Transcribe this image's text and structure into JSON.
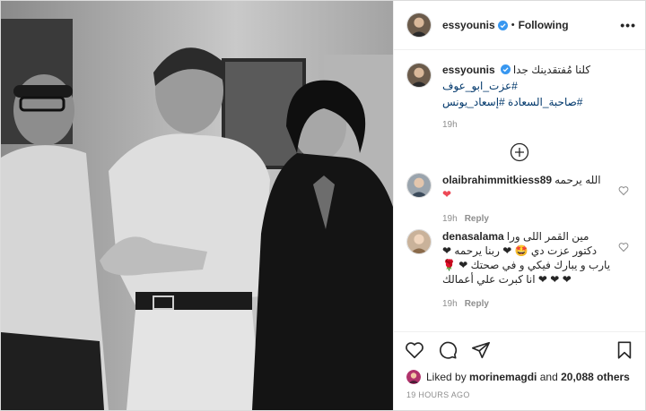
{
  "header": {
    "username": "essyounis",
    "separator": "•",
    "follow_label": "Following",
    "more_label": "•••"
  },
  "caption": {
    "username": "essyounis",
    "text": "كلنا مُفتقدينك جدا",
    "tags": [
      "#عزت_ابو_عوف",
      "#إسعاد_يونس",
      "#صاحبة_السعادة"
    ],
    "time": "19h"
  },
  "comments": [
    {
      "username": "olaibrahimmitkiess89",
      "text": "الله يرحمه",
      "emoji": "❤",
      "time": "19h",
      "reply_label": "Reply"
    },
    {
      "username": "denasalama",
      "text": "مين القمر اللى ورا دكتور عزت دي 🤩 ❤ ربنا يرحمه ❤ يارب و يبارك فيكي و في صحتك ❤ 🌹❤ ❤ ❤ انا كبرت علي أعمالك",
      "time": "19h",
      "reply_label": "Reply"
    }
  ],
  "likes": {
    "prefix": "Liked by",
    "user": "morinemagdi",
    "conjunction": "and",
    "others": "20,088 others"
  },
  "posted_ago": "19 HOURS AGO",
  "icons": {
    "verified": "verified-badge-icon",
    "like": "heart-outline-icon",
    "comment": "comment-bubble-icon",
    "share": "paper-plane-icon",
    "save": "bookmark-icon",
    "load_more": "plus-circle-icon"
  },
  "colors": {
    "verified": "#3897f0",
    "heart": "#ed4956",
    "link": "#00376b",
    "muted": "#8e8e8e"
  }
}
